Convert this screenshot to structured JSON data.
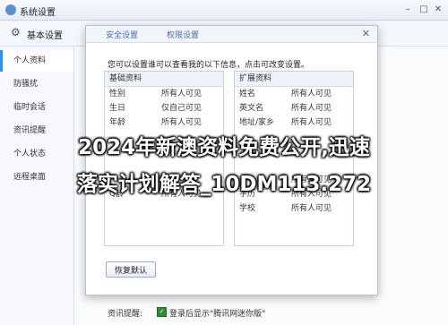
{
  "window": {
    "title": "系统设置",
    "subbar_title": "基本设置"
  },
  "sidebar": {
    "items": [
      {
        "label": "个人资料",
        "active": true
      },
      {
        "label": "防骚扰",
        "active": false
      },
      {
        "label": "临时会话",
        "active": false
      },
      {
        "label": "资讯提醒",
        "active": false
      },
      {
        "label": "个人状态",
        "active": false
      },
      {
        "label": "远程桌面",
        "active": false
      }
    ]
  },
  "dialog": {
    "tabs": [
      "安全设置",
      "权限设置"
    ],
    "intro": "您可以设置谁可以查看我的以下信息，点击可改变设置。",
    "basic": {
      "header": "基础资料",
      "rows": [
        {
          "k": "性别",
          "v": "所有人可见"
        },
        {
          "k": "生日",
          "v": "仅自己可见"
        },
        {
          "k": "年龄",
          "v": "所有人可见"
        },
        {
          "k": "",
          "v": ""
        },
        {
          "k": "",
          "v": ""
        },
        {
          "k": "",
          "v": ""
        },
        {
          "k": "",
          "v": ""
        },
        {
          "k": "Q龄",
          "v": "所有人可见"
        }
      ]
    },
    "extended": {
      "header": "扩展资料",
      "rows": [
        {
          "k": "姓名",
          "v": "所有人可见"
        },
        {
          "k": "英文名",
          "v": "所有人可见"
        },
        {
          "k": "地址/家乡",
          "v": "所有人可见"
        },
        {
          "k": "",
          "v": ""
        },
        {
          "k": "",
          "v": ""
        },
        {
          "k": "",
          "v": ""
        },
        {
          "k": "",
          "v": "所有人可见"
        },
        {
          "k": "学历",
          "v": "所有人可见"
        },
        {
          "k": "学校",
          "v": "所有人可见"
        }
      ]
    },
    "reset_label": "恢复默认"
  },
  "footer": {
    "label": "资讯提醒:",
    "checkbox_text": "登录后显示\"腾讯网迷你版\""
  },
  "watermark": {
    "line1": "2024年新澳资料免费公开,迅速",
    "line2": "落实计划解答_10DM113.272"
  }
}
